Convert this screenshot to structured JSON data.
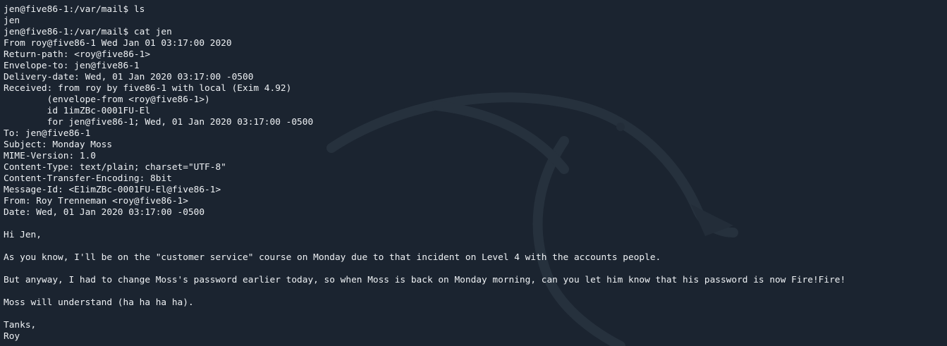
{
  "terminal": {
    "background": "#1b2430",
    "foreground": "#eef1f4",
    "lines": [
      "jen@five86-1:/var/mail$ ls",
      "jen",
      "jen@five86-1:/var/mail$ cat jen",
      "From roy@five86-1 Wed Jan 01 03:17:00 2020",
      "Return-path: <roy@five86-1>",
      "Envelope-to: jen@five86-1",
      "Delivery-date: Wed, 01 Jan 2020 03:17:00 -0500",
      "Received: from roy by five86-1 with local (Exim 4.92)",
      "        (envelope-from <roy@five86-1>)",
      "        id 1imZBc-0001FU-El",
      "        for jen@five86-1; Wed, 01 Jan 2020 03:17:00 -0500",
      "To: jen@five86-1",
      "Subject: Monday Moss",
      "MIME-Version: 1.0",
      "Content-Type: text/plain; charset=\"UTF-8\"",
      "Content-Transfer-Encoding: 8bit",
      "Message-Id: <E1imZBc-0001FU-El@five86-1>",
      "From: Roy Trenneman <roy@five86-1>",
      "Date: Wed, 01 Jan 2020 03:17:00 -0500",
      "",
      "Hi Jen,",
      "",
      "As you know, I'll be on the \"customer service\" course on Monday due to that incident on Level 4 with the accounts people.",
      "",
      "But anyway, I had to change Moss's password earlier today, so when Moss is back on Monday morning, can you let him know that his password is now Fire!Fire!",
      "",
      "Moss will understand (ha ha ha ha).",
      "",
      "Tanks,",
      "Roy"
    ]
  },
  "icons": {
    "watermark": "kali-dragon-icon"
  }
}
